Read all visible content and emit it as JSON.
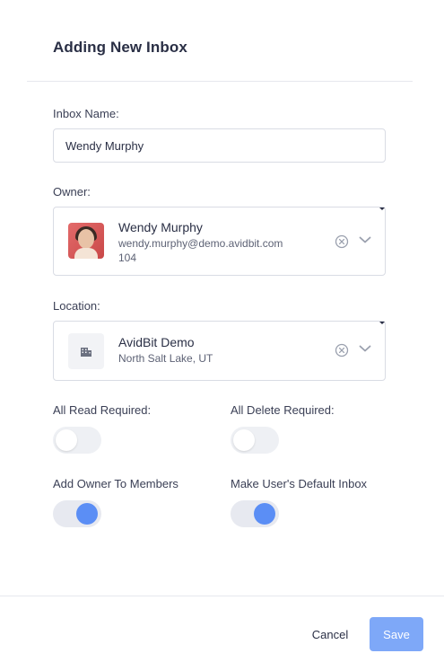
{
  "modal": {
    "title": "Adding New Inbox"
  },
  "inbox_name": {
    "label": "Inbox Name:",
    "value": "Wendy Murphy"
  },
  "owner": {
    "label": "Owner:",
    "name": "Wendy Murphy",
    "email": "wendy.murphy@demo.avidbit.com",
    "id": "104"
  },
  "location": {
    "label": "Location:",
    "name": "AvidBit Demo",
    "address": "North Salt Lake, UT"
  },
  "toggles": {
    "all_read_required": {
      "label": "All Read Required:",
      "on": false
    },
    "all_delete_required": {
      "label": "All Delete Required:",
      "on": false
    },
    "add_owner_to_members": {
      "label": "Add Owner To Members",
      "on": true
    },
    "make_default_inbox": {
      "label": "Make User's Default Inbox",
      "on": true
    }
  },
  "footer": {
    "cancel_label": "Cancel",
    "save_label": "Save"
  },
  "colors": {
    "accent": "#5b8ef5",
    "save_button": "#7ea8f8"
  }
}
